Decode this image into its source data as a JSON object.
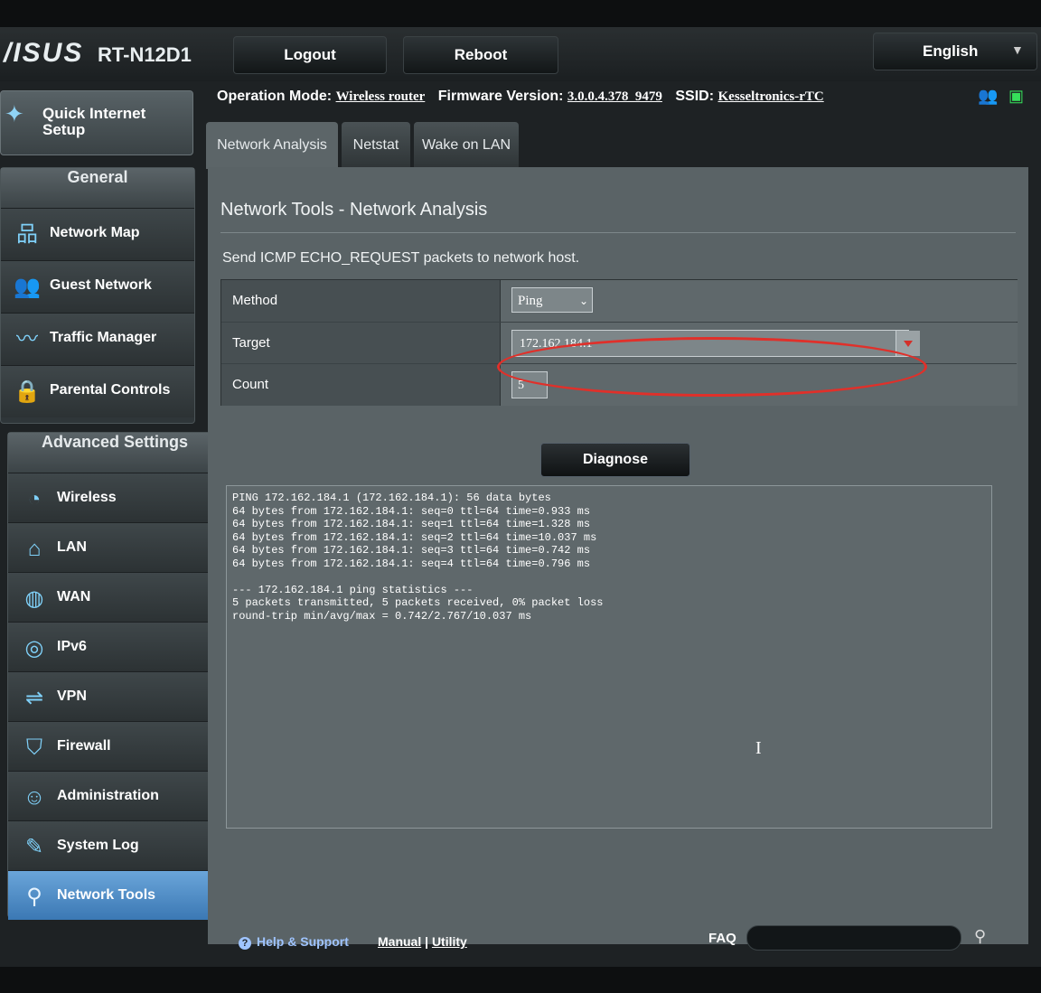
{
  "header": {
    "logo": "/ISUS",
    "model": "RT-N12D1",
    "logout_label": "Logout",
    "reboot_label": "Reboot",
    "language": "English"
  },
  "infobar": {
    "op_mode_label": "Operation Mode:",
    "op_mode_value": "Wireless router",
    "firmware_label": "Firmware Version:",
    "firmware_value": "3.0.0.4.378_9479",
    "ssid_label": "SSID:",
    "ssid_value": "Kesseltronics-rTC"
  },
  "sidebar": {
    "quick_setup": "Quick Internet Setup",
    "general_title": "General",
    "general_items": [
      {
        "label": "Network Map",
        "icon": "network-map-icon"
      },
      {
        "label": "Guest Network",
        "icon": "guest-network-icon"
      },
      {
        "label": "Traffic Manager",
        "icon": "traffic-manager-icon"
      },
      {
        "label": "Parental Controls",
        "icon": "parental-controls-icon"
      }
    ],
    "advanced_title": "Advanced Settings",
    "advanced_items": [
      {
        "label": "Wireless",
        "icon": "wireless-icon"
      },
      {
        "label": "LAN",
        "icon": "lan-icon"
      },
      {
        "label": "WAN",
        "icon": "wan-icon"
      },
      {
        "label": "IPv6",
        "icon": "ipv6-icon"
      },
      {
        "label": "VPN",
        "icon": "vpn-icon"
      },
      {
        "label": "Firewall",
        "icon": "firewall-icon"
      },
      {
        "label": "Administration",
        "icon": "administration-icon"
      },
      {
        "label": "System Log",
        "icon": "system-log-icon"
      },
      {
        "label": "Network Tools",
        "icon": "network-tools-icon"
      }
    ]
  },
  "tabs": [
    "Network Analysis",
    "Netstat",
    "Wake on LAN"
  ],
  "main": {
    "title": "Network Tools - Network Analysis",
    "description": "Send ICMP ECHO_REQUEST packets to network host.",
    "method_label": "Method",
    "method_value": "Ping",
    "target_label": "Target",
    "target_value": "172.162.184.1",
    "count_label": "Count",
    "count_value": "5",
    "diagnose_label": "Diagnose",
    "output": "PING 172.162.184.1 (172.162.184.1): 56 data bytes\n64 bytes from 172.162.184.1: seq=0 ttl=64 time=0.933 ms\n64 bytes from 172.162.184.1: seq=1 ttl=64 time=1.328 ms\n64 bytes from 172.162.184.1: seq=2 ttl=64 time=10.037 ms\n64 bytes from 172.162.184.1: seq=3 ttl=64 time=0.742 ms\n64 bytes from 172.162.184.1: seq=4 ttl=64 time=0.796 ms\n\n--- 172.162.184.1 ping statistics ---\n5 packets transmitted, 5 packets received, 0% packet loss\nround-trip min/avg/max = 0.742/2.767/10.037 ms"
  },
  "footer": {
    "help_label": "Help & Support",
    "manual_label": "Manual",
    "utility_label": "Utility",
    "separator": "|",
    "faq_label": "FAQ"
  },
  "colors": {
    "accent": "#3b78b4",
    "highlight_ring": "#e0302a"
  }
}
